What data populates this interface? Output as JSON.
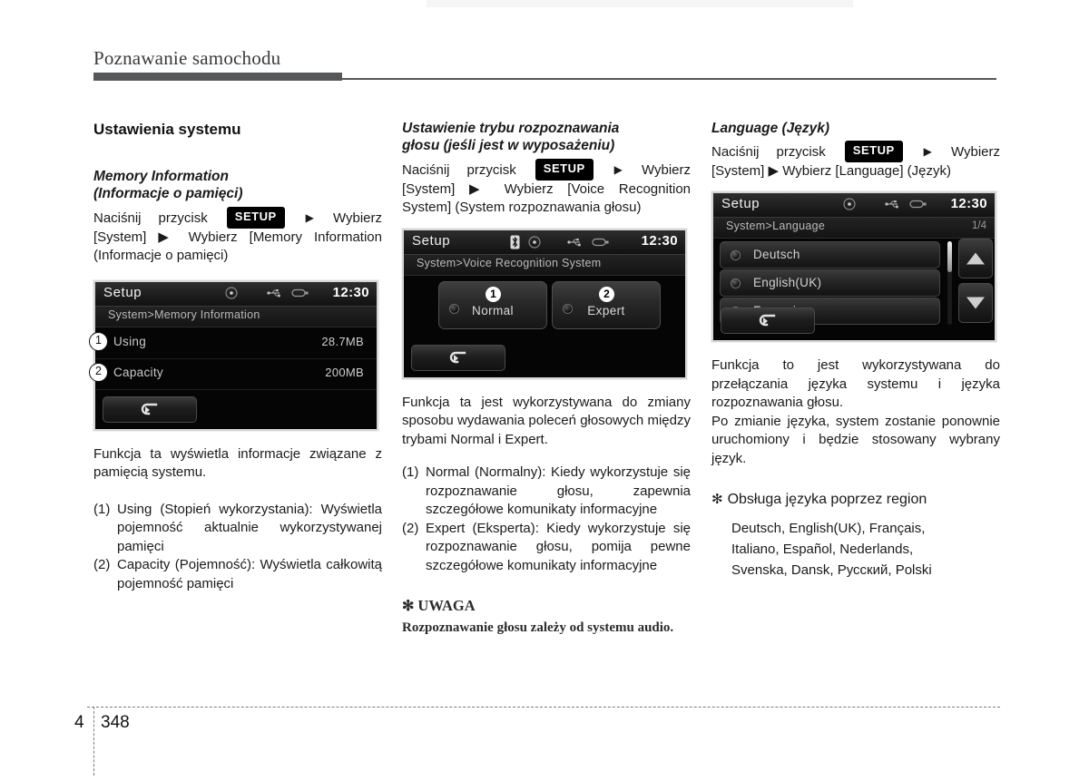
{
  "header": {
    "chapter_title": "Poznawanie samochodu",
    "ghost_text": ""
  },
  "footer": {
    "chapter_number": "4",
    "page_number": "348"
  },
  "columns": {
    "left": {
      "section_title": "Ustawienia systemu",
      "sub_title_line1": "Memory Information",
      "sub_title_line2": "(Informacje o pamięci)",
      "instruction_pre": "Naciśnij przycisk",
      "setup_chip": "SETUP",
      "instruction_mid": "Wybierz",
      "instruction_rest": "[System] ▶ Wybierz [Memory Information (Informacje o pamięci)",
      "screen": {
        "title": "Setup",
        "clock": "12:30",
        "breadcrumb": "System>Memory Information",
        "rows": [
          {
            "callout": "1",
            "label": "Using",
            "value": "28.7MB"
          },
          {
            "callout": "2",
            "label": "Capacity",
            "value": "200MB"
          }
        ],
        "back_button": "back-arrow"
      },
      "description": "Funkcja ta wyświetla informacje związane z pamięcią systemu.",
      "items": [
        {
          "marker": "(1)",
          "text": "Using (Stopień wykorzystania): Wyświetla pojemność aktualnie wykorzystywanej pamięci"
        },
        {
          "marker": "(2)",
          "text": "Capacity (Pojemność): Wyświetla całkowitą pojemność pamięci"
        }
      ]
    },
    "middle": {
      "sub_title_line1": "Ustawienie trybu rozpoznawania",
      "sub_title_line2": "głosu (jeśli jest w wyposażeniu)",
      "instruction_pre": "Naciśnij  przycisk",
      "setup_chip": "SETUP",
      "instruction_mid": "Wybierz",
      "instruction_rest": "[System] ▶ Wybierz [Voice Recognition System] (System rozpoznawania głosu)",
      "screen": {
        "title": "Setup",
        "clock": "12:30",
        "breadcrumb": "System>Voice Recognition System",
        "options": [
          {
            "callout": "1",
            "label": "Normal"
          },
          {
            "callout": "2",
            "label": "Expert"
          }
        ],
        "back_button": "back-arrow"
      },
      "description": "Funkcja ta jest wykorzystywana do zmiany sposobu wydawania poleceń głosowych między trybami Normal i Expert.",
      "items": [
        {
          "marker": "(1)",
          "text": "Normal (Normalny): Kiedy wykorzystuje się rozpoznawanie głosu, zapewnia szczegółowe komunikaty informacyjne"
        },
        {
          "marker": "(2)",
          "text": "Expert (Eksperta): Kiedy wykorzystuje się rozpoznawanie głosu, pomija pewne szczegółowe komunikaty informacyjne"
        }
      ],
      "note": {
        "star": "✻",
        "heading": "UWAGA",
        "body": "Rozpoznawanie głosu zależy od systemu audio."
      }
    },
    "right": {
      "sub_title": "Language (Język)",
      "instruction_pre": "Naciśnij przycisk",
      "setup_chip": "SETUP",
      "instruction_mid": "Wybierz",
      "instruction_rest": "[System] ▶ Wybierz [Language] (Język)",
      "screen": {
        "title": "Setup",
        "clock": "12:30",
        "breadcrumb": "System>Language",
        "page_indicator": "1/4",
        "languages": [
          "Deutsch",
          "English(UK)",
          "Français"
        ],
        "back_button": "back-arrow",
        "scroll_up": "up-arrow",
        "scroll_down": "down-arrow"
      },
      "description_1": "Funkcja to jest wykorzystywana do przełączania języka systemu i języka rozpoznawania głosu.",
      "description_2": "Po zmianie języka, system zostanie ponownie uruchomiony i będzie stosowany wybrany język.",
      "region": {
        "star": "✻",
        "heading": "Obsługa języka poprzez region",
        "lines": [
          "Deutsch, English(UK), Français,",
          "Italiano, Español, Nederlands,",
          "Svenska, Dansk, Русский, Polski"
        ]
      }
    }
  },
  "colors": {
    "rule": "#555759",
    "screen_bg": "#070707",
    "chip_bg": "#000000"
  }
}
